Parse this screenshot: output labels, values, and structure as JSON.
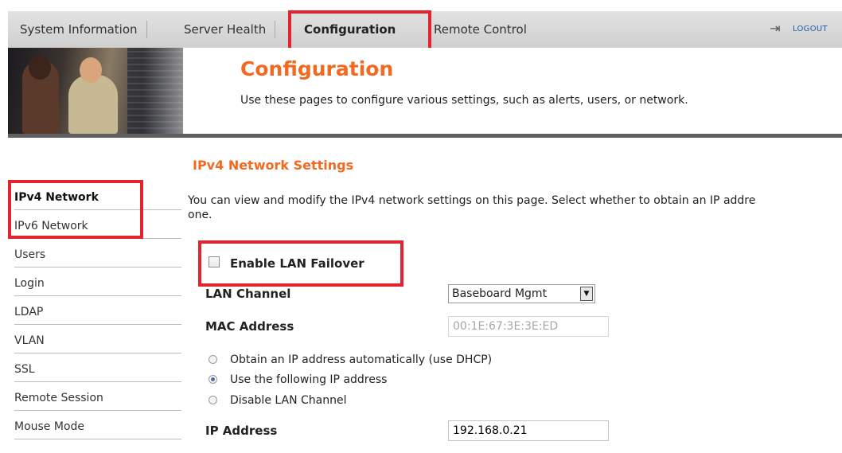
{
  "colors": {
    "accent": "#f26a21",
    "highlight": "#e3232d",
    "link": "#1a5ea8"
  },
  "topnav": {
    "tabs": [
      {
        "label": "System Information"
      },
      {
        "label": "Server Health"
      },
      {
        "label": "Configuration",
        "active": true
      },
      {
        "label": "Remote Control"
      }
    ],
    "logout_icon": "logout-icon",
    "logout_label": "LOGOUT"
  },
  "banner": {
    "title": "Configuration",
    "description": "Use these pages to configure various settings, such as alerts, users, or network."
  },
  "sidebar": {
    "items": [
      {
        "label": "IPv4 Network",
        "active": true
      },
      {
        "label": "IPv6 Network"
      },
      {
        "label": "Users"
      },
      {
        "label": "Login"
      },
      {
        "label": "LDAP"
      },
      {
        "label": "VLAN"
      },
      {
        "label": "SSL"
      },
      {
        "label": "Remote Session"
      },
      {
        "label": "Mouse Mode"
      }
    ]
  },
  "main": {
    "section_title": "IPv4 Network Settings",
    "intro_line1": "You can view and modify the IPv4 network settings on this page. Select whether to obtain an IP addre",
    "intro_line2": "one.",
    "enable_failover": {
      "label": "Enable LAN Failover",
      "checked": false
    },
    "lan_channel": {
      "label": "LAN Channel",
      "value": "Baseboard Mgmt"
    },
    "mac_address": {
      "label": "MAC Address",
      "value": "00:1E:67:3E:3E:ED"
    },
    "ip_mode": {
      "options": [
        "Obtain an IP address automatically (use DHCP)",
        "Use the following IP address",
        "Disable LAN Channel"
      ],
      "selected": "Use the following IP address"
    },
    "ip_address": {
      "label": "IP Address",
      "value": "192.168.0.21"
    }
  }
}
